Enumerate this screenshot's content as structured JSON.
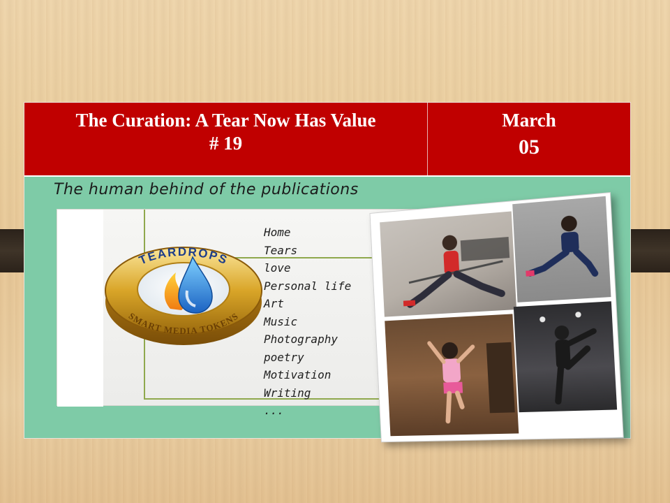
{
  "header": {
    "title_line1": "The Curation: A Tear Now Has Value",
    "title_line2": "# 19",
    "month": "March",
    "day": "05"
  },
  "subtitle": "The human behind of the publications",
  "logo": {
    "top_text": "TEARDROPS",
    "bottom_text": "SMART MEDIA TOKENS"
  },
  "menu": [
    "Home",
    "Tears",
    "love",
    "Personal life",
    "Art",
    "Music",
    "Photography",
    "poetry",
    "Motivation",
    "Writing",
    "..."
  ],
  "colors": {
    "header_red": "#c00000",
    "body_green": "#7ecba7",
    "frame_line": "#8fa84d"
  }
}
